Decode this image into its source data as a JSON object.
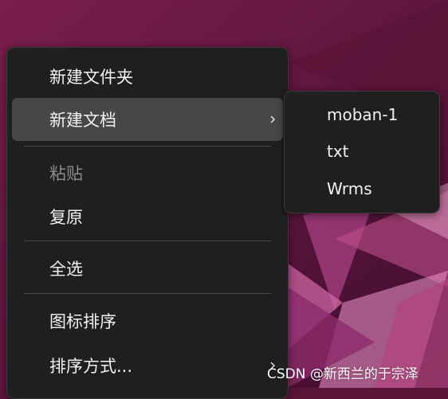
{
  "theme": {
    "menu_bg": "#1f1f1f",
    "hover_bg": "#474747",
    "text": "#f2f2f2",
    "disabled_text": "#8a8a8a",
    "desktop_bg": "#5a1438"
  },
  "context_menu": {
    "items": [
      {
        "label": "新建文件夹"
      },
      {
        "label": "新建文档",
        "icon": "chevron-right-icon"
      },
      {
        "label": "粘贴"
      },
      {
        "label": "复原"
      },
      {
        "label": "全选"
      },
      {
        "label": "图标排序"
      },
      {
        "label": "排序方式...",
        "icon": "chevron-right-icon"
      }
    ]
  },
  "submenu": {
    "items": [
      {
        "label": "moban-1"
      },
      {
        "label": "txt"
      },
      {
        "label": "Wrms"
      }
    ]
  },
  "watermark": "CSDN @新西兰的于宗泽"
}
